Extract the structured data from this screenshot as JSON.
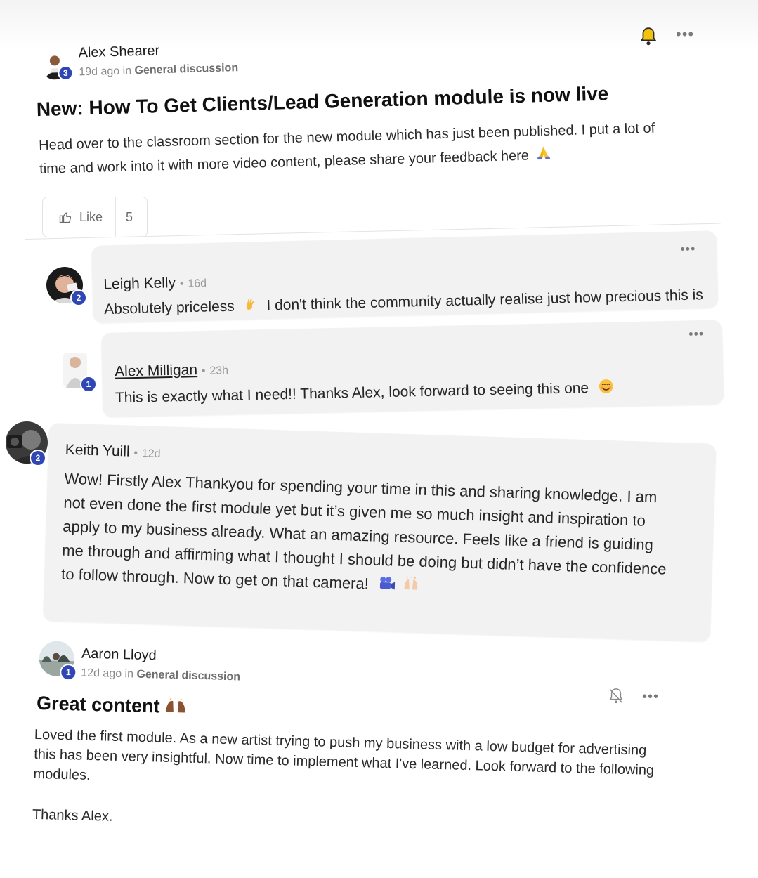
{
  "post": {
    "author": "Alex Shearer",
    "level": "3",
    "time_ago": "19d ago in",
    "category": "General discussion",
    "title": "New: How To Get Clients/Lead Generation module is now live",
    "body_line1": "Head over to the classroom section for the new module which has just been published. I put a lot of",
    "body_line2": "time and work into it with more video content, please share your feedback here",
    "like_label": "Like",
    "like_count": "5",
    "icons": [
      "bell-icon",
      "more-options-icon",
      "thumbs-up-icon",
      "folded-hands-emoji"
    ]
  },
  "comments": [
    {
      "author": "Leigh Kelly",
      "level": "2",
      "separator": "•",
      "time": "16d",
      "text_before": "Absolutely priceless",
      "text_after": "I don't think the community actually realise just how precious this is",
      "emoji": "ok-hand-emoji"
    },
    {
      "author": "Alex Milligan",
      "level": "1",
      "separator": "•",
      "time": "23h",
      "text": "This is exactly what I need!! Thanks Alex, look forward to seeing this one",
      "emoji": "smiling-face-emoji"
    },
    {
      "author": "Keith Yuill",
      "level": "2",
      "separator": "•",
      "time": "12d",
      "lines": [
        "Wow! Firstly Alex Thankyou for spending your time in this and sharing knowledge. I am",
        "not even done the first module yet but it’s given me so much insight and inspiration to",
        "apply to my business already. What an amazing resource. Feels like a friend is guiding",
        "me through and affirming what I thought I should be doing but didn’t have the confidence",
        "to follow through. Now to get on that camera!"
      ],
      "emojis": [
        "movie-camera-emoji",
        "raising-hands-emoji"
      ]
    }
  ],
  "second_post": {
    "author": "Aaron Lloyd",
    "level": "1",
    "time_ago": "12d ago in",
    "category": "General discussion",
    "title": "Great content",
    "title_emoji": "raising-hands-emoji",
    "lines": [
      "Loved the first module. As a new artist trying to push my business with a low budget for advertising",
      "this has been very insightful. Now time to implement what I've learned. Look forward to the following",
      "modules."
    ],
    "sign_off": "Thanks Alex.",
    "icons": [
      "bell-off-icon",
      "more-options-icon"
    ]
  },
  "colors": {
    "level_badge": "#2f46b5",
    "bubble_bg": "#f2f2f2",
    "bell_fill": "#f4c20d",
    "meta_text": "#8a8a8a"
  }
}
